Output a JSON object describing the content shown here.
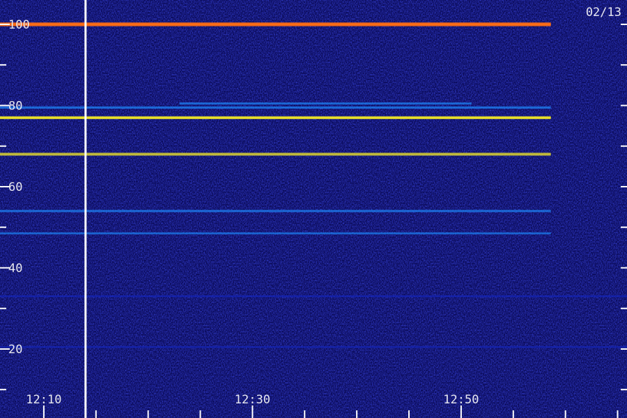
{
  "chart_data": {
    "type": "heatmap",
    "title": "",
    "xlabel": "",
    "ylabel": "",
    "date_label": "02/13",
    "colormap": [
      "#05052a",
      "#0a0a6e",
      "#1428c8",
      "#1e8cff",
      "#1ee6c8",
      "#f0e628",
      "#ff6e14"
    ],
    "x_ticks": [
      {
        "label": "12:10",
        "minute": 10
      },
      {
        "label": "12:30",
        "minute": 30
      },
      {
        "label": "12:50",
        "minute": 50
      }
    ],
    "x_minor_step_minutes": 5,
    "xlim_minutes": [
      5.8,
      65.9
    ],
    "y_ticks": [
      {
        "label": "20",
        "value": 20
      },
      {
        "label": "40",
        "value": 40
      },
      {
        "label": "60",
        "value": 60
      },
      {
        "label": "80",
        "value": 80
      },
      {
        "label": "100",
        "value": 100
      }
    ],
    "y_minor_step": 10,
    "ylim": [
      3,
      106
    ],
    "marker_line_minute": 14.0,
    "bands": [
      {
        "freq": 100.0,
        "intensity": 0.82,
        "t_start": 5.8,
        "t_end": 58.6
      },
      {
        "freq": 77.0,
        "intensity": 0.55,
        "t_start": 5.8,
        "t_end": 58.6
      },
      {
        "freq": 79.5,
        "intensity": 0.3,
        "t_start": 5.8,
        "t_end": 58.6
      },
      {
        "freq": 80.5,
        "intensity": 0.25,
        "t_start": 23.0,
        "t_end": 51.0
      },
      {
        "freq": 68.0,
        "intensity": 0.5,
        "t_start": 5.8,
        "t_end": 58.6
      },
      {
        "freq": 54.0,
        "intensity": 0.3,
        "t_start": 5.8,
        "t_end": 58.6
      },
      {
        "freq": 48.5,
        "intensity": 0.22,
        "t_start": 5.8,
        "t_end": 58.6
      },
      {
        "freq": 33.0,
        "intensity": 0.12,
        "t_start": 5.8,
        "t_end": 65.9
      },
      {
        "freq": 20.5,
        "intensity": 0.1,
        "t_start": 5.8,
        "t_end": 65.9
      }
    ]
  }
}
